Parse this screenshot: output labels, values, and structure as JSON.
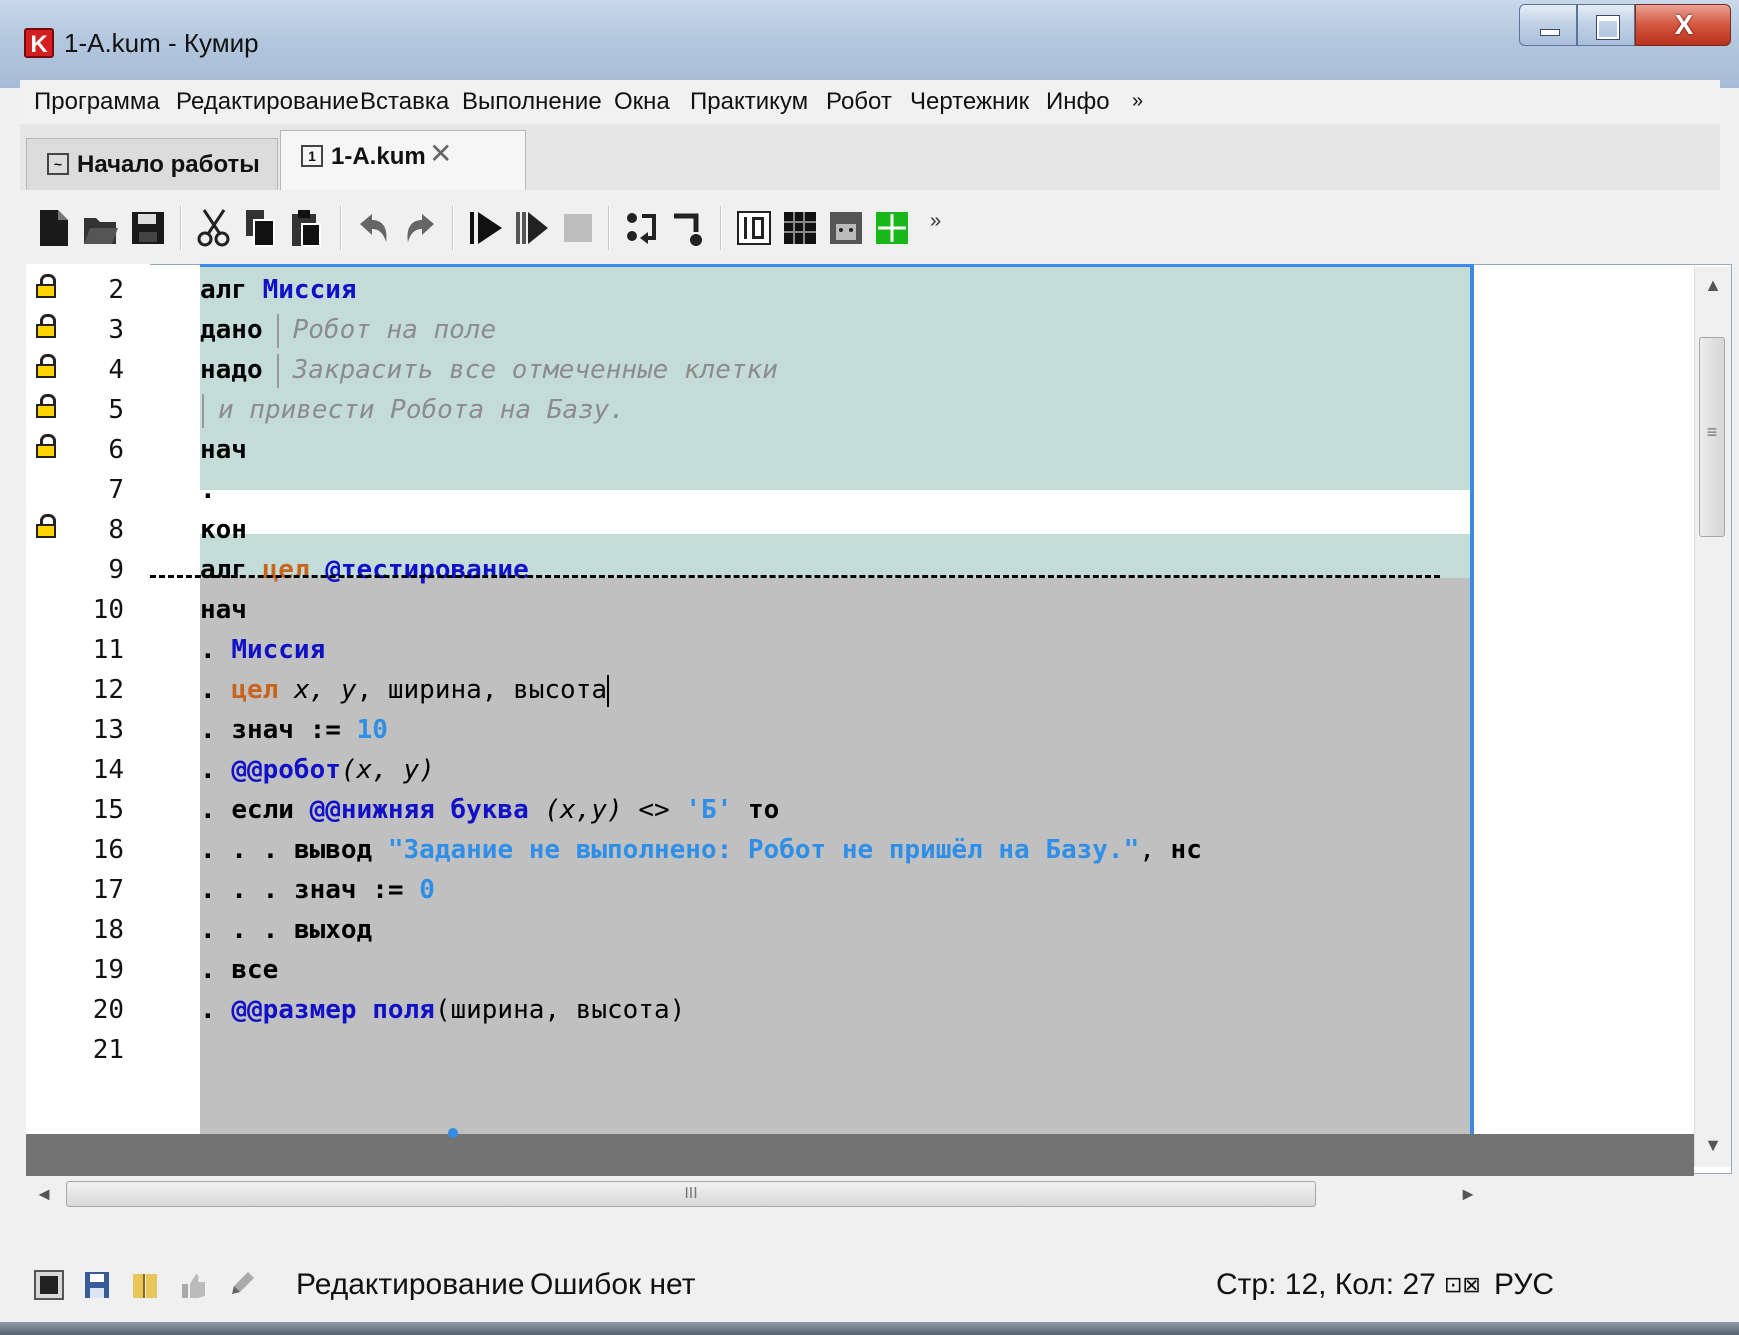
{
  "window": {
    "title": "1-A.kum - Кумир",
    "app_icon_letter": "K"
  },
  "menu": {
    "items": [
      "Программа",
      "Редактирование",
      "Вставка",
      "Выполнение",
      "Окна",
      "Практикум",
      "Робот",
      "Чертежник",
      "Инфо"
    ],
    "more": "»"
  },
  "tabs": [
    {
      "label": "Начало работы",
      "icon": "wave-icon",
      "icon_text": "~"
    },
    {
      "label": "1-A.kum",
      "icon": "number-one-icon",
      "icon_text": "1",
      "close": "✕"
    }
  ],
  "toolbar": {
    "more": "»",
    "icons": [
      "new-file-icon",
      "open-folder-icon",
      "save-icon",
      "cut-icon",
      "copy-icon",
      "paste-icon",
      "undo-icon",
      "redo-icon",
      "run-icon",
      "step-icon",
      "stop-icon",
      "step-in-icon",
      "step-out-icon",
      "variables-icon",
      "robot-field-icon",
      "robot-remote-icon",
      "drawer-icon"
    ]
  },
  "editor": {
    "line_numbers": [
      "2",
      "3",
      "4",
      "5",
      "6",
      "7",
      "8",
      "9",
      "10",
      "11",
      "12",
      "13",
      "14",
      "15",
      "16",
      "17",
      "18",
      "19",
      "20",
      "21"
    ],
    "locked_lines": [
      "2",
      "3",
      "4",
      "5",
      "6",
      "8"
    ],
    "lines": {
      "l2": {
        "kw": "алг",
        "name": "Миссия"
      },
      "l3": {
        "kw": "дано",
        "comment": "Робот на поле"
      },
      "l4": {
        "kw": "надо",
        "comment": "Закрасить все отмеченные клетки"
      },
      "l5": {
        "comment": "и привести Робота на Базу."
      },
      "l6": {
        "kw": "нач"
      },
      "l7": {
        "dot": "."
      },
      "l8": {
        "kw": "кон"
      },
      "l9": {
        "kw": "алг",
        "type": "цел",
        "name": "@тестирование"
      },
      "l10": {
        "kw": "нач"
      },
      "l11": {
        "dot": ".",
        "name": "Миссия"
      },
      "l12": {
        "dot": ".",
        "type": "цел",
        "vars_italic": "x, y",
        "rest": ", ширина, высота"
      },
      "l13": {
        "dot": ".",
        "kw": "знач",
        "op": ":=",
        "num": "10"
      },
      "l14": {
        "dot": ".",
        "name": "@@робот",
        "args": "(x, y)"
      },
      "l15": {
        "dot": ".",
        "kw": "если",
        "name": "@@нижняя буква",
        "args": "(x,y)",
        "op": "<>",
        "str": "'Б'",
        "kw2": "то"
      },
      "l16": {
        "dot": ". . .",
        "kw": "вывод",
        "str": "\"Задание не выполнено: Робот не пришёл на Базу.\"",
        "sep": ",",
        "kw2": "нс"
      },
      "l17": {
        "dot": ". . .",
        "kw": "знач",
        "op": ":=",
        "num": "0"
      },
      "l18": {
        "dot": ". . .",
        "kw": "выход"
      },
      "l19": {
        "dot": ".",
        "kw": "все"
      },
      "l20": {
        "dot": ".",
        "name": "@@размер поля",
        "args": "(ширина, высота)"
      }
    }
  },
  "scrollbars": {
    "v_grip": "≡",
    "h_grip": "III",
    "up": "▲",
    "down": "▼",
    "left": "◄",
    "right": "►"
  },
  "status": {
    "mode": "Редактирование",
    "errors": "Ошибок нет",
    "position": "Стр: 12, Кол: 27",
    "keyboard": "РУС",
    "keyboard_icons": "⊡⊠"
  },
  "colors": {
    "protected_bg": "#c3dcd7",
    "hidden_bg": "#c0c0c0",
    "keyword": "#000000",
    "algorithm_name": "#1010c8",
    "type": "#c8641e",
    "literal": "#2f8fe8",
    "comment": "#8c8c8c",
    "margin_line": "#3b8ae6"
  }
}
